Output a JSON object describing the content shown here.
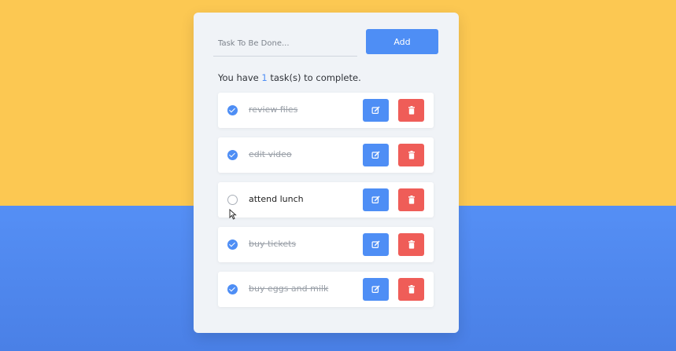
{
  "input": {
    "placeholder": "Task To Be Done...",
    "value": ""
  },
  "add_button": {
    "label": "Add"
  },
  "summary": {
    "prefix": "You have ",
    "count": "1",
    "suffix": " task(s) to complete."
  },
  "tasks": [
    {
      "text": "review files",
      "done": true
    },
    {
      "text": "edit video",
      "done": true
    },
    {
      "text": "attend lunch",
      "done": false
    },
    {
      "text": "buy tickets",
      "done": true
    },
    {
      "text": "buy eggs and milk",
      "done": true
    }
  ],
  "icons": {
    "edit": "edit-icon",
    "delete": "trash-icon",
    "check": "check-icon"
  },
  "colors": {
    "background_top": "#fcc852",
    "background_bottom": "#558ff5",
    "accent": "#4e8ef5",
    "danger": "#ef5d58"
  }
}
